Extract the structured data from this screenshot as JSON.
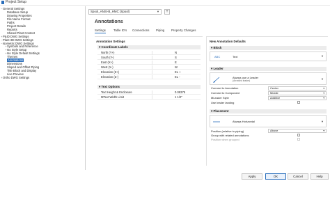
{
  "window": {
    "title": "Project Setup"
  },
  "tree": [
    {
      "label": "General Settings",
      "depth": 0,
      "toggle": "-"
    },
    {
      "label": "Database Setup",
      "depth": 1,
      "toggle": ""
    },
    {
      "label": "Drawing Properties",
      "depth": 1,
      "toggle": ""
    },
    {
      "label": "File Name Format",
      "depth": 1,
      "toggle": ""
    },
    {
      "label": "Paths",
      "depth": 1,
      "toggle": ""
    },
    {
      "label": "Project Details",
      "depth": 1,
      "toggle": ""
    },
    {
      "label": "Reports",
      "depth": 1,
      "toggle": ""
    },
    {
      "label": "Shared Plant Content",
      "depth": 1,
      "toggle": ""
    },
    {
      "label": "P&ID DWG Settings",
      "depth": 0,
      "toggle": "+"
    },
    {
      "label": "Plant 3D DWG Settings",
      "depth": 0,
      "toggle": "-"
    },
    {
      "label": "Isometric DWG Settings",
      "depth": 0,
      "toggle": "-"
    },
    {
      "label": "Symbols and Reference",
      "depth": 1,
      "toggle": "+"
    },
    {
      "label": "Iso Style Setup",
      "depth": 1,
      "toggle": "+"
    },
    {
      "label": "Iso Style Default Settings",
      "depth": 1,
      "toggle": "+"
    },
    {
      "label": "Themes",
      "depth": 1,
      "toggle": ""
    },
    {
      "label": "Annotations",
      "depth": 1,
      "toggle": "",
      "selected": true
    },
    {
      "label": "Dimensions",
      "depth": 1,
      "toggle": ""
    },
    {
      "label": "Sloped and Offset Piping",
      "depth": 1,
      "toggle": ""
    },
    {
      "label": "Title Block and Display",
      "depth": 1,
      "toggle": ""
    },
    {
      "label": "Live Preview",
      "depth": 1,
      "toggle": ""
    },
    {
      "label": "Ortho DWG Settings",
      "depth": 0,
      "toggle": "+"
    }
  ],
  "spec": {
    "selected": "Spool_ANSI-B_HMC (Spool)",
    "add_label": "+"
  },
  "main": {
    "heading": "Annotations",
    "tabs": [
      {
        "label": "Settings",
        "active": true
      },
      {
        "label": "Table ID's",
        "active": false
      },
      {
        "label": "Connections",
        "active": false
      },
      {
        "label": "Piping",
        "active": false
      },
      {
        "label": "Property Changes",
        "active": false
      }
    ]
  },
  "annotation_settings": {
    "title": "Annotation Settings",
    "coordinate_labels": {
      "header": "Coordinate Labels",
      "rows": [
        {
          "name": "North (Y+)",
          "value": "N"
        },
        {
          "name": "South (Y-)",
          "value": "S"
        },
        {
          "name": "East (X+)",
          "value": "E"
        },
        {
          "name": "West (X-)",
          "value": "W"
        },
        {
          "name": "Elevation (Z+)",
          "value": "EL +"
        },
        {
          "name": "Elevation (Z-)",
          "value": "EL -"
        }
      ]
    },
    "text_options": {
      "header": "Text Options",
      "rows": [
        {
          "name": "Text Height & Enclosure",
          "value": "0.09375"
        },
        {
          "name": "MText Width Limit",
          "value": "1 1/2\""
        }
      ]
    }
  },
  "defaults": {
    "title": "New Annotation Defaults",
    "block": {
      "header": "Block",
      "sample": "ABC",
      "label": "Text"
    },
    "leader": {
      "header": "Leader",
      "option_label": "Always use a Leader",
      "option_sub": "(Arrowed leader)",
      "connect_annotation_label": "Connect to Annotation",
      "connect_annotation_value": "Center",
      "connect_component_label": "Connect to Component",
      "connect_component_value": "Middle",
      "mleader_label": "MLeader Style",
      "mleader_value": "Additive",
      "landing_label": "Use leader landing"
    },
    "placement": {
      "header": "Placement",
      "option_label": "Always Horizontal",
      "position_label": "Position (relative to piping)",
      "position_value": "Above",
      "group_label": "Group with related annotations",
      "grouped_label": "Position when grouped"
    }
  },
  "buttons": {
    "apply": "Apply",
    "ok": "OK",
    "cancel": "Cancel",
    "help": "Help"
  }
}
